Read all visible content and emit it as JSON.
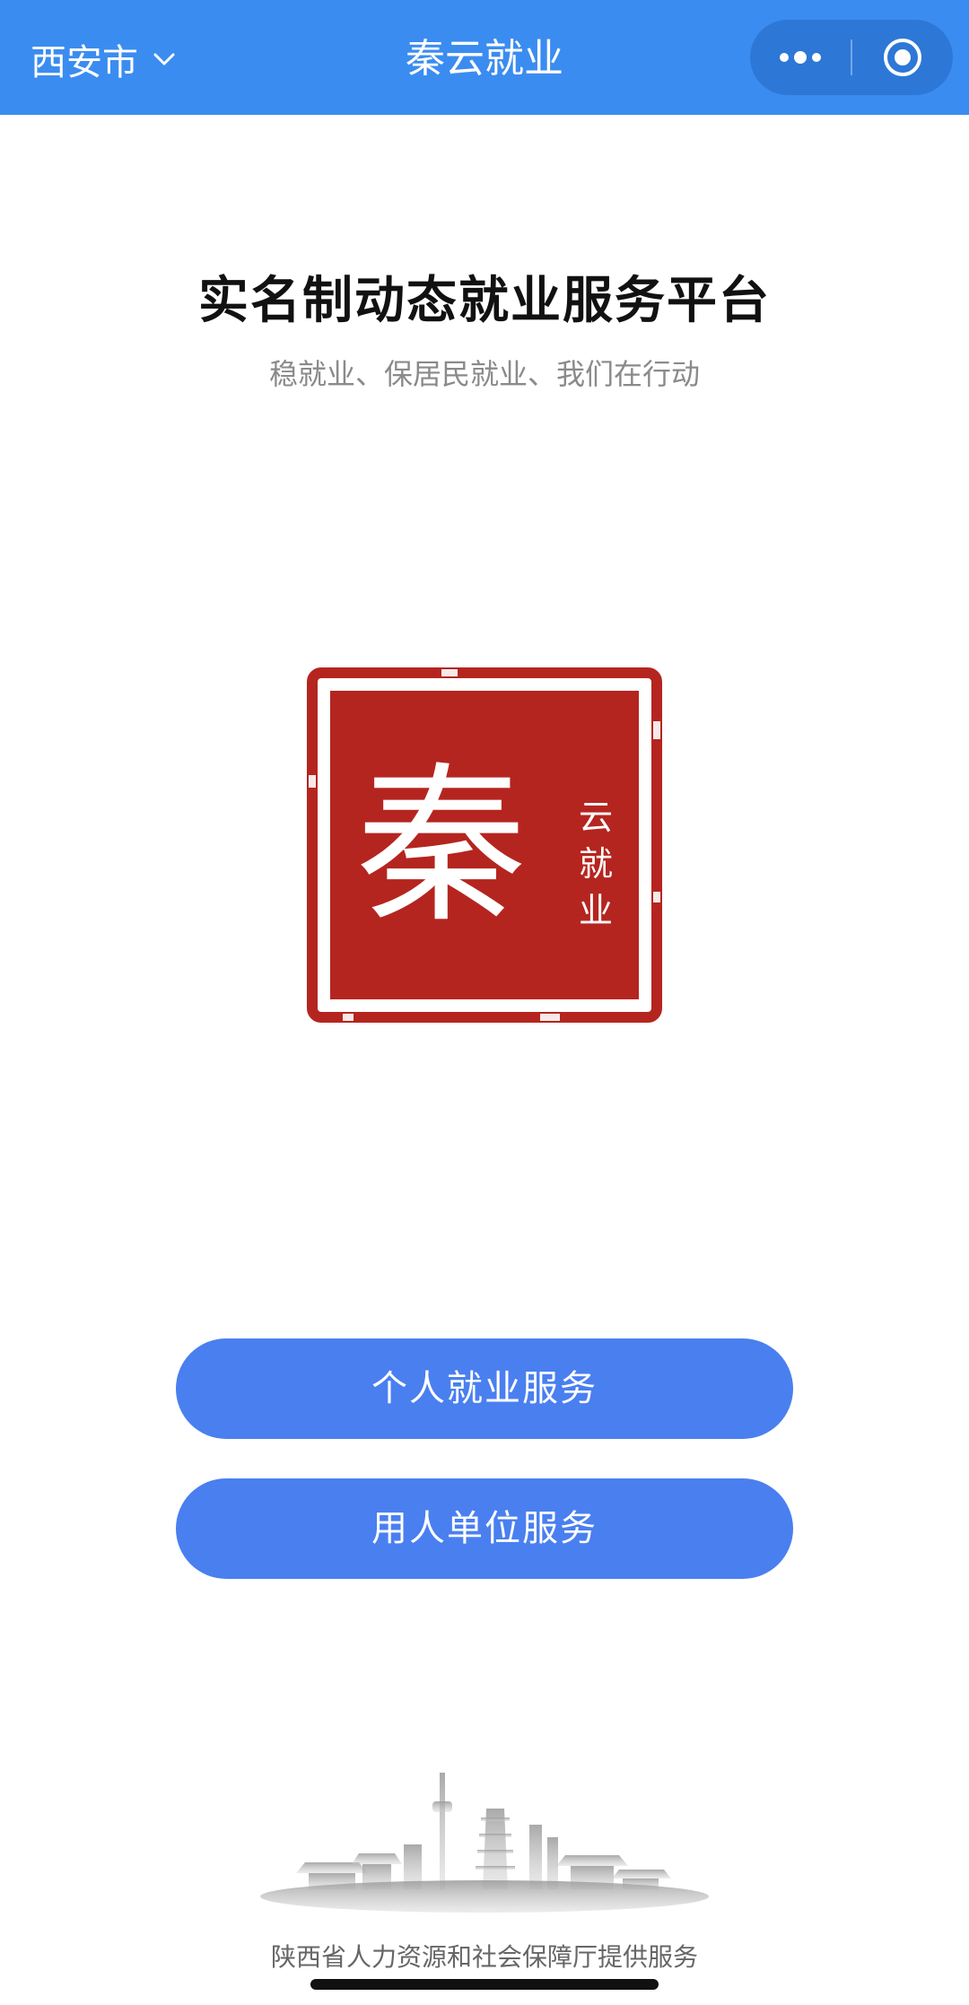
{
  "navbar": {
    "city": "西安市",
    "title": "秦云就业",
    "bg_color": "#3b8cf0",
    "more_icon": "more-dots-icon",
    "target_icon": "target-circle-icon"
  },
  "hero": {
    "title": "实名制动态就业服务平台",
    "subtitle": "稳就业、保居民就业、我们在行动"
  },
  "logo": {
    "main_char": "秦",
    "side_text": "云就业",
    "seal_color": "#b5251f"
  },
  "actions": {
    "personal": "个人就业服务",
    "employer": "用人单位服务",
    "button_color": "#4a7ff0"
  },
  "footer": {
    "text": "陕西省人力资源和社会保障厅提供服务"
  }
}
